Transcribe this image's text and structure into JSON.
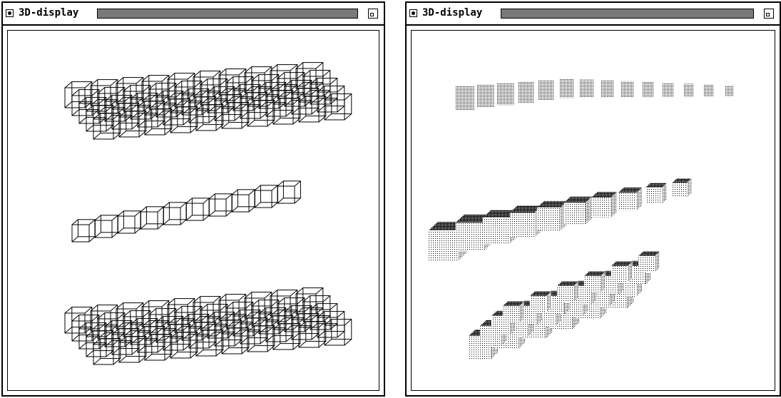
{
  "windows": [
    {
      "title": "3D-display",
      "render_style": "wireframe"
    },
    {
      "title": "3D-display",
      "render_style": "shaded"
    }
  ],
  "icons": {
    "close": "close-box-icon",
    "zoom": "zoom-box-icon"
  },
  "colors": {
    "foreground": "#000000",
    "background": "#ffffff"
  }
}
